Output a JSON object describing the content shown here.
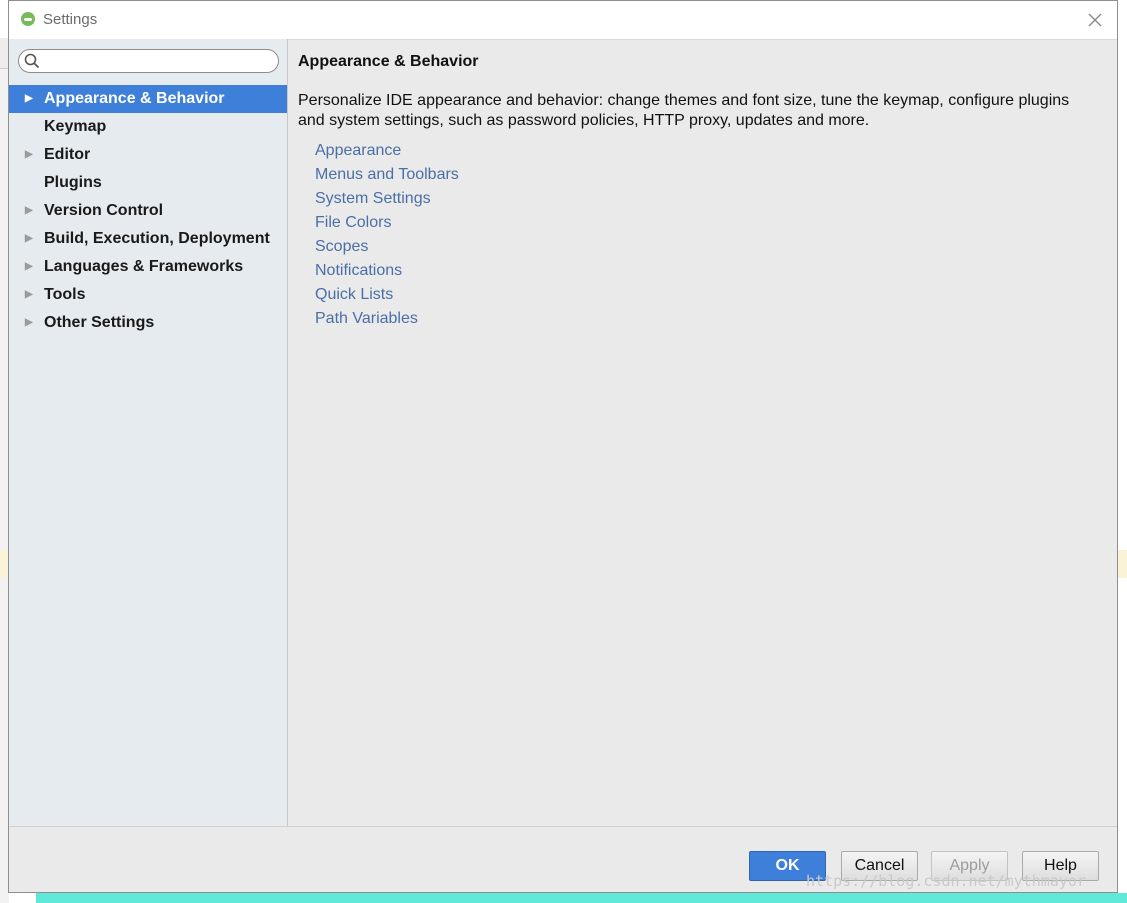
{
  "window": {
    "title": "Settings"
  },
  "search": {
    "value": "",
    "placeholder": ""
  },
  "tree": {
    "items": [
      {
        "label": "Appearance & Behavior",
        "expandable": true,
        "selected": true
      },
      {
        "label": "Keymap",
        "expandable": false,
        "selected": false
      },
      {
        "label": "Editor",
        "expandable": true,
        "selected": false
      },
      {
        "label": "Plugins",
        "expandable": false,
        "selected": false
      },
      {
        "label": "Version Control",
        "expandable": true,
        "selected": false
      },
      {
        "label": "Build, Execution, Deployment",
        "expandable": true,
        "selected": false
      },
      {
        "label": "Languages & Frameworks",
        "expandable": true,
        "selected": false
      },
      {
        "label": "Tools",
        "expandable": true,
        "selected": false
      },
      {
        "label": "Other Settings",
        "expandable": true,
        "selected": false
      }
    ]
  },
  "content": {
    "title": "Appearance & Behavior",
    "description": "Personalize IDE appearance and behavior: change themes and font size, tune the keymap, configure plugins and system settings, such as password policies, HTTP proxy, updates and more.",
    "links": [
      "Appearance",
      "Menus and Toolbars",
      "System Settings",
      "File Colors",
      "Scopes",
      "Notifications",
      "Quick Lists",
      "Path Variables"
    ]
  },
  "footer": {
    "ok_label": "OK",
    "cancel_label": "Cancel",
    "apply_label": "Apply",
    "help_label": "Help"
  },
  "watermark": "https://blog.csdn.net/mythmayor",
  "colors": {
    "accent": "#3d7fd9",
    "link": "#4a6fa8",
    "sidebar_bg": "#e6ebf0",
    "panel_bg": "#eaeaea"
  },
  "icons": {
    "app": "android-studio-icon",
    "close": "close-icon",
    "search": "search-icon",
    "expand": "triangle-right-icon"
  }
}
